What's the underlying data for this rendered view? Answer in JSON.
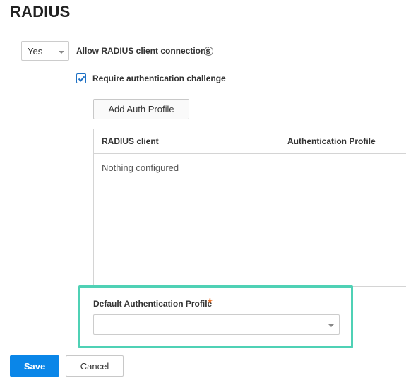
{
  "page": {
    "title": "RADIUS"
  },
  "connections": {
    "select_value": "Yes",
    "label": "Allow RADIUS client connections",
    "info_icon": "info-circle-icon"
  },
  "challenge": {
    "label": "Require authentication challenge",
    "checked": true
  },
  "auth_profiles": {
    "add_button": "Add Auth Profile",
    "columns": [
      "RADIUS client",
      "Authentication Profile"
    ],
    "rows": [],
    "empty_message": "Nothing configured"
  },
  "default_profile": {
    "label": "Default Authentication Profile",
    "required_marker": "*",
    "value": ""
  },
  "footer": {
    "save_label": "Save",
    "cancel_label": "Cancel"
  },
  "colors": {
    "primary": "#0a86e8",
    "highlight": "#4fd1b5",
    "required": "#f07023"
  }
}
